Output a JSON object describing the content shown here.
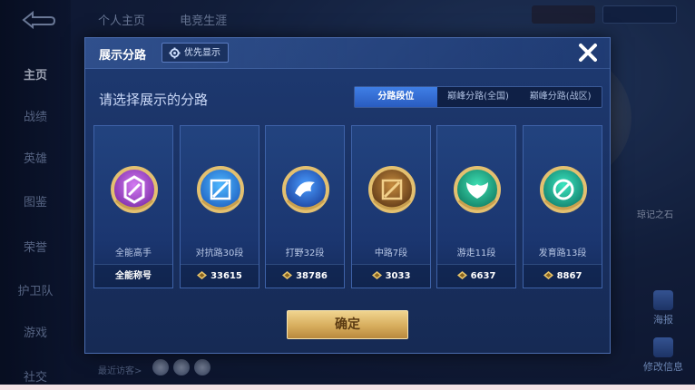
{
  "background": {
    "nav_items": [
      {
        "label": "主页",
        "active": true
      },
      {
        "label": "战绩",
        "active": false
      },
      {
        "label": "英雄",
        "active": false
      },
      {
        "label": "图鉴",
        "active": false
      },
      {
        "label": "荣誉",
        "active": false
      },
      {
        "label": "护卫队",
        "active": false
      },
      {
        "label": "游戏",
        "active": false
      },
      {
        "label": "社交",
        "active": false
      }
    ],
    "top_tabs": [
      "个人主页",
      "电竞生涯"
    ],
    "recent_visitors_label": "最近访客>",
    "side_right": [
      "海报",
      "修改信息"
    ],
    "bg_chip": "琼记之石"
  },
  "modal": {
    "title": "展示分路",
    "priority_button": "优先显示",
    "subtitle": "请选择展示的分路",
    "filter_tabs": [
      {
        "label": "分路段位",
        "active": true
      },
      {
        "label": "巅峰分路(全国)",
        "active": false
      },
      {
        "label": "巅峰分路(战区)",
        "active": false
      }
    ],
    "cards": [
      {
        "label": "全能高手",
        "footer": "全能称号",
        "has_points": false,
        "badge": "purple"
      },
      {
        "label": "对抗路30段",
        "footer": "33615",
        "has_points": true,
        "badge": "blue-sword"
      },
      {
        "label": "打野32段",
        "footer": "38786",
        "has_points": true,
        "badge": "blue-dragon"
      },
      {
        "label": "中路7段",
        "footer": "3033",
        "has_points": true,
        "badge": "gold-slash"
      },
      {
        "label": "游走11段",
        "footer": "6637",
        "has_points": true,
        "badge": "green-wings"
      },
      {
        "label": "发育路13段",
        "footer": "8867",
        "has_points": true,
        "badge": "green-shield"
      }
    ],
    "confirm_button": "确定"
  },
  "colors": {
    "accent_blue": "#3f7fe6",
    "confirm_gold": "#d7ad5d",
    "panel_bg": "#1b3670"
  }
}
